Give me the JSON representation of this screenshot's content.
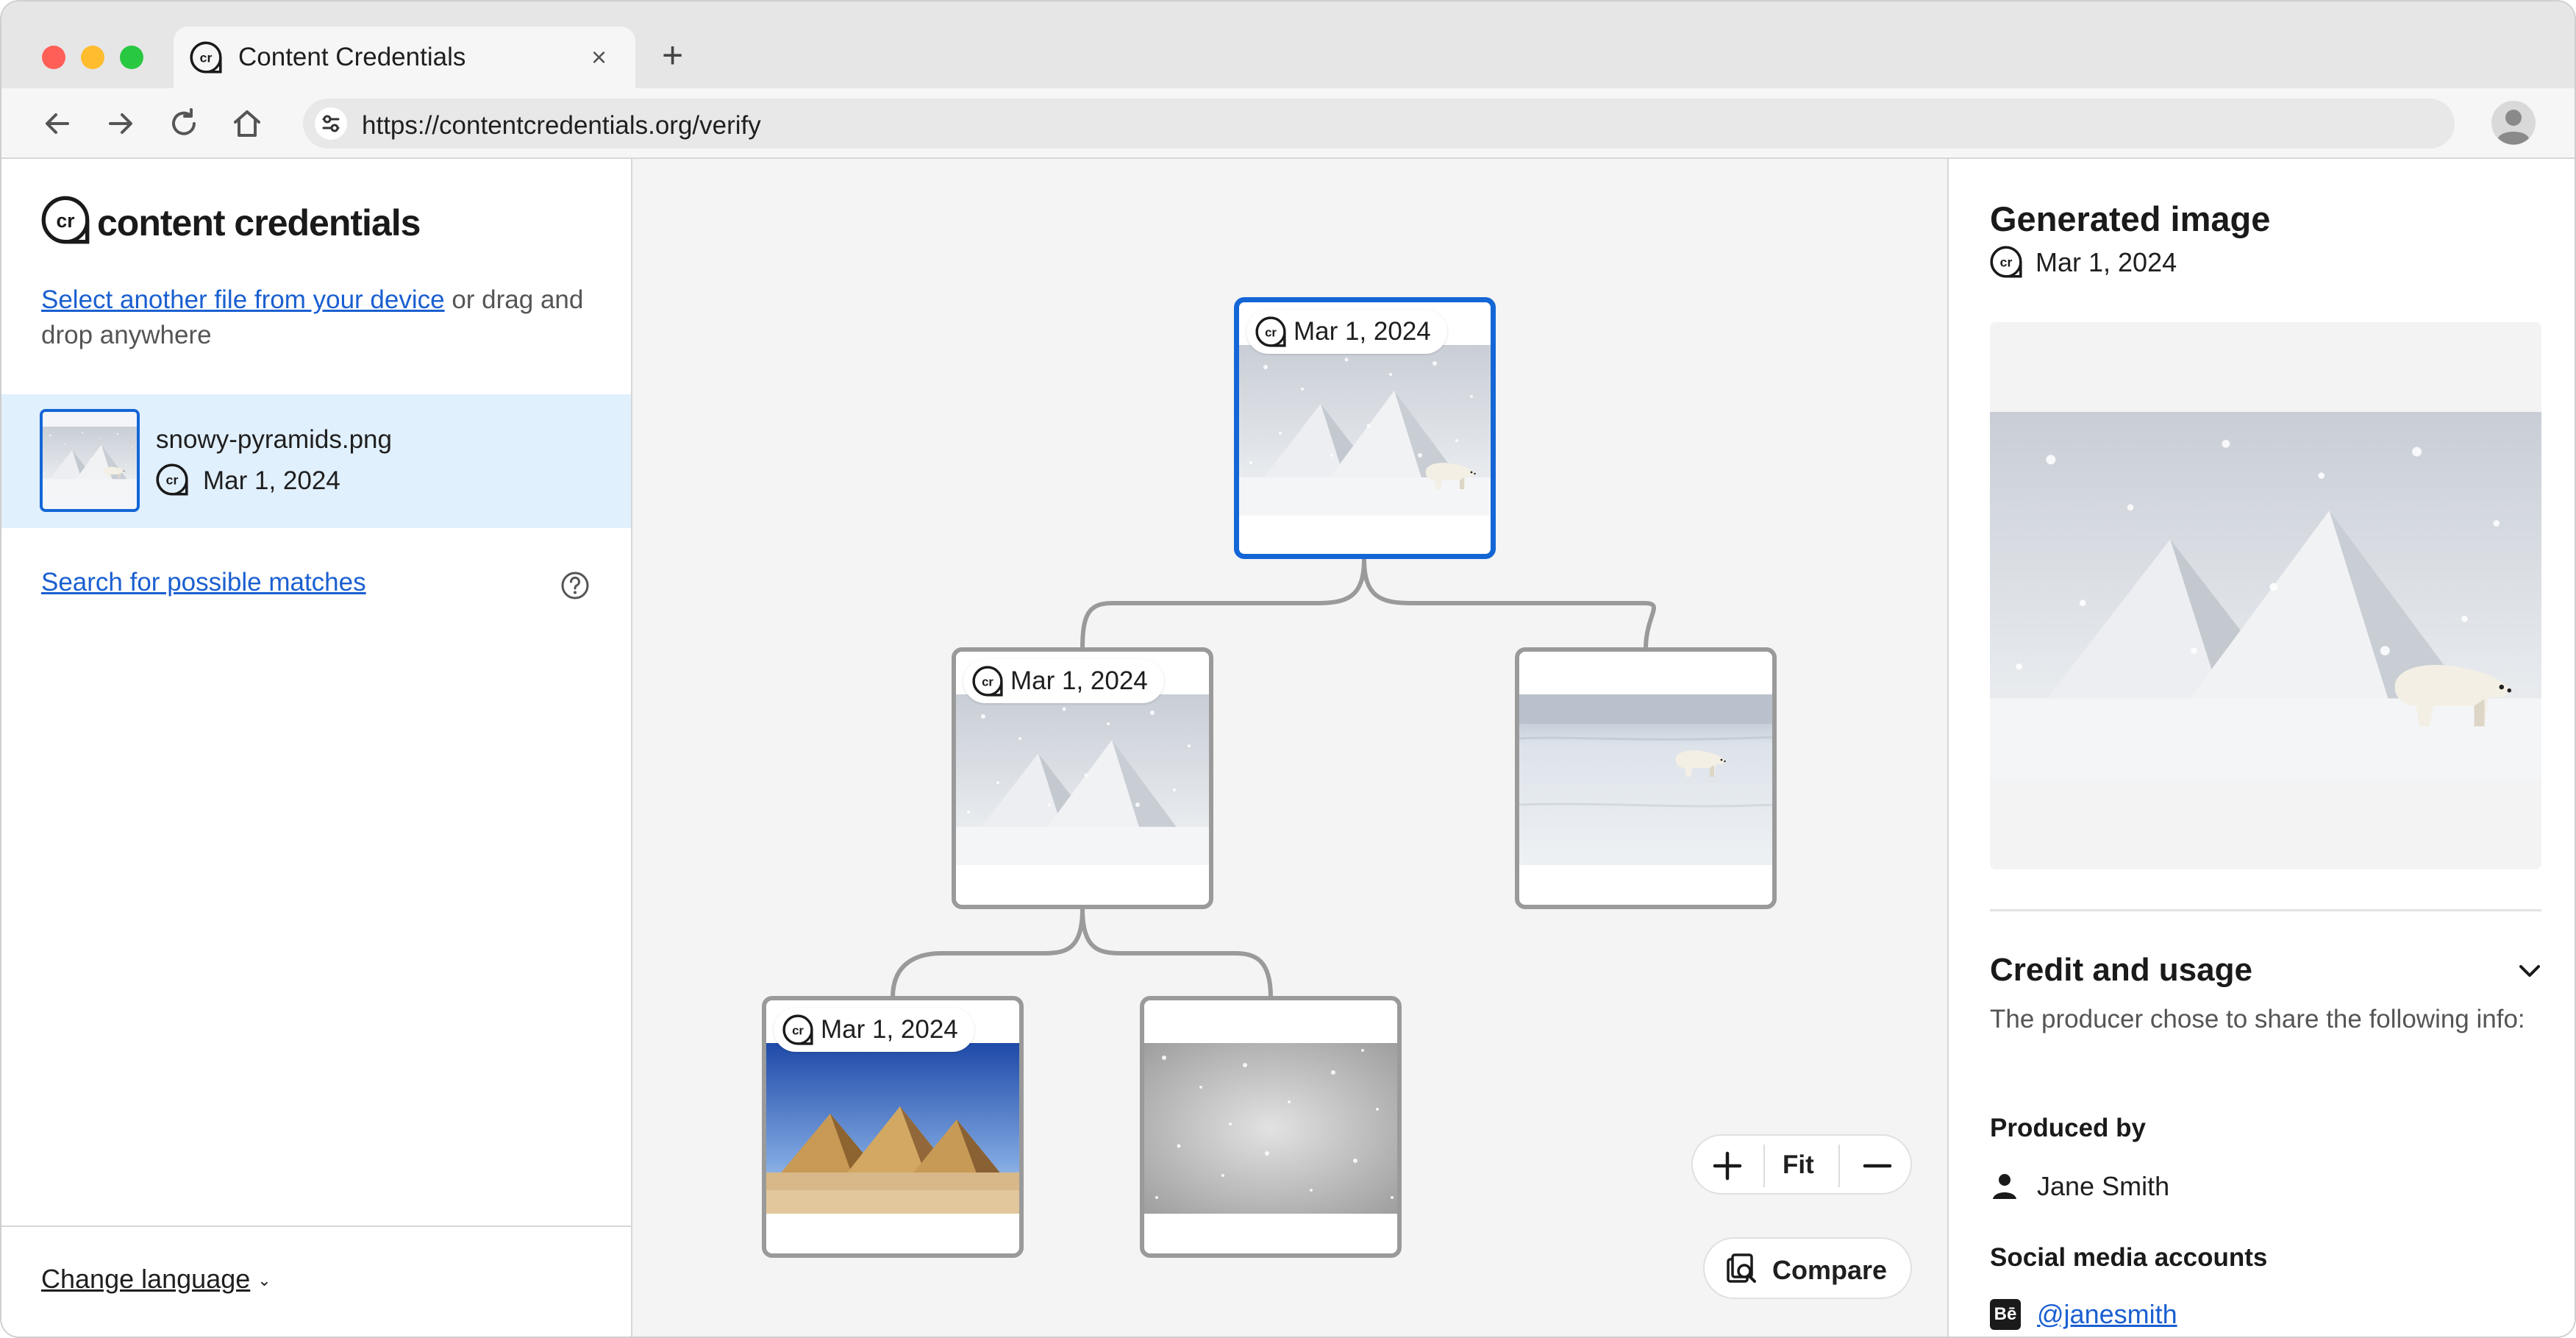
{
  "browser": {
    "tab_title": "Content Credentials",
    "tab_close": "×",
    "new_tab": "+",
    "url": "https://contentcredentials.org/verify"
  },
  "sidebar": {
    "brand": "content credentials",
    "select_link": "Select another file from your device",
    "select_rest": " or drag and drop anywhere",
    "file": {
      "name": "snowy-pyramids.png",
      "date": "Mar 1, 2024"
    },
    "search_link": "Search for possible matches",
    "language_button": "Change language"
  },
  "canvas": {
    "nodes": [
      {
        "id": "root",
        "date": "Mar 1, 2024",
        "image": "snowy-pyramids-polar-bear",
        "selected": true
      },
      {
        "id": "snowy-pyramids",
        "date": "Mar 1, 2024",
        "image": "snowy-pyramids",
        "selected": false
      },
      {
        "id": "polar-bear",
        "date": "",
        "image": "polar-bear-on-ice",
        "selected": false
      },
      {
        "id": "desert-pyramids",
        "date": "Mar 1, 2024",
        "image": "desert-pyramids",
        "selected": false
      },
      {
        "id": "snow-texture",
        "date": "",
        "image": "snow-texture",
        "selected": false
      }
    ],
    "zoom": {
      "fit_label": "Fit"
    },
    "compare_label": "Compare"
  },
  "panel": {
    "title": "Generated image",
    "date": "Mar 1, 2024",
    "credit_heading": "Credit and usage",
    "credit_desc": "The producer chose to share the following info:",
    "produced_by_label": "Produced by",
    "producer": "Jane Smith",
    "social_label": "Social media accounts",
    "social_handle": "@janesmith",
    "social_platform_glyph": "Bē"
  },
  "colors": {
    "accent_blue": "#1466d6",
    "selected_row": "#e1f0fd",
    "link": "#1a5fd0",
    "canvas_bg": "#f4f4f4"
  }
}
